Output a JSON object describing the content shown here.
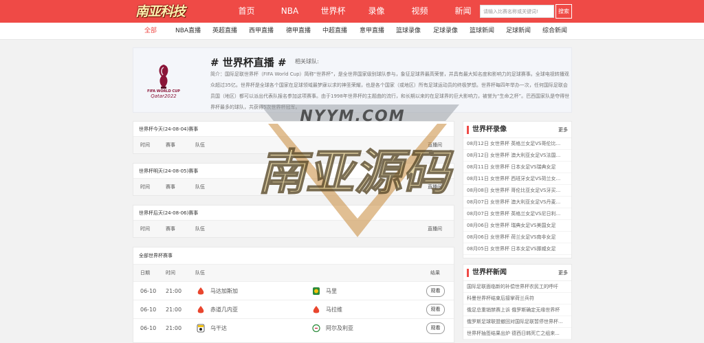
{
  "header": {
    "logo": "南亚科技",
    "nav": [
      "首页",
      "NBA",
      "世界杯",
      "录像",
      "视频",
      "新闻"
    ],
    "search_placeholder": "请输入比赛名称或关键词!",
    "search_button": "搜索"
  },
  "subnav": [
    "全部",
    "NBA直播",
    "英超直播",
    "西甲直播",
    "德甲直播",
    "中超直播",
    "意甲直播",
    "篮球录像",
    "足球录像",
    "篮球新闻",
    "足球新闻",
    "综合新闻"
  ],
  "intro": {
    "title": "# 世界杯直播 #",
    "related": "相关球队:",
    "logo_text": "FIFA WORLD CUP Qatar2022",
    "desc": "简介：国际足联世界杯（FIFA World Cup）简称“世界杯”，是全世界国家级别球队参与，象征足球界最高荣誉，并具有最大知名度和影响力的足球赛事。全球电视转播观众超过35亿。世界杯是全球各个国家在足球领域最梦寐以求的神圣荣耀，也是各个国家（或地区）所有足球运动员的终极梦想。世界杯每四年举办一次，任何国际足联会员国（地区）都可以派出代表队报名参加这项赛事。由于1998年世界杯的主题曲的流行，和长期以来的在足球界的巨大影响力，被誉为“生命之杯”。巴西国家队是夺得世界杯最多的球队，共获得5次世界杯冠军。"
  },
  "columns": {
    "time": "时间",
    "event": "赛事",
    "teams": "队伍",
    "live": "直播间",
    "date": "日期",
    "result": "结果"
  },
  "panels": [
    {
      "title": "世界杯今天(24-08-04)赛事"
    },
    {
      "title": "世界杯明天(24-08-05)赛事"
    },
    {
      "title": "世界杯后天(24-08-06)赛事"
    }
  ],
  "all_panel": {
    "title": "全部世界杯赛事",
    "rows": [
      {
        "date": "06-10",
        "time": "21:00",
        "home": "马达加斯加",
        "away": "马里",
        "button": "观看"
      },
      {
        "date": "06-10",
        "time": "21:00",
        "home": "赤道几内亚",
        "away": "马拉维",
        "button": "观看"
      },
      {
        "date": "06-10",
        "time": "21:00",
        "home": "乌干达",
        "away": "阿尔及利亚",
        "button": "观看"
      }
    ]
  },
  "side_videos": {
    "title": "世界杯录像",
    "more": "更多",
    "items": [
      "08月12日 女世界杯 英格兰女足VS哥伦比...",
      "08月12日 女世界杯 澳大利亚女足VS法国...",
      "08月11日 女世界杯 日本女足VS瑞典女足",
      "08月11日 女世界杯 西班牙女足VS荷兰女...",
      "08月08日 女世界杯 哥伦比亚女足VS牙买...",
      "08月07日 女世界杯 澳大利亚女足VS丹麦...",
      "08月07日 女世界杯 英格兰女足VS尼日利...",
      "08月06日 女世界杯 瑞典女足VS美国女足",
      "08月06日 女世界杯 荷兰女足VS南非女足",
      "08月05日 女世界杯 日本女足VS挪威女足"
    ]
  },
  "side_news": {
    "title": "世界杯新闻",
    "more": "更多",
    "items": [
      "国际足联面临新的补偿世界杯农民工的呼吁",
      "科曼世界杯结束后接掌荷兰兵符",
      "俄足总重销禁赛上诉 俄罗斯确定无缘世界杯",
      "俄罗斯足球联盟撤回对国际足联暂停世界杯...",
      "世界杯抽签结果出炉 德西日韩死亡之组来..."
    ]
  },
  "watermark": {
    "line1": "NYYM.COM",
    "line2": "南亚源码"
  },
  "colors": {
    "brand": "#ef4a46"
  }
}
